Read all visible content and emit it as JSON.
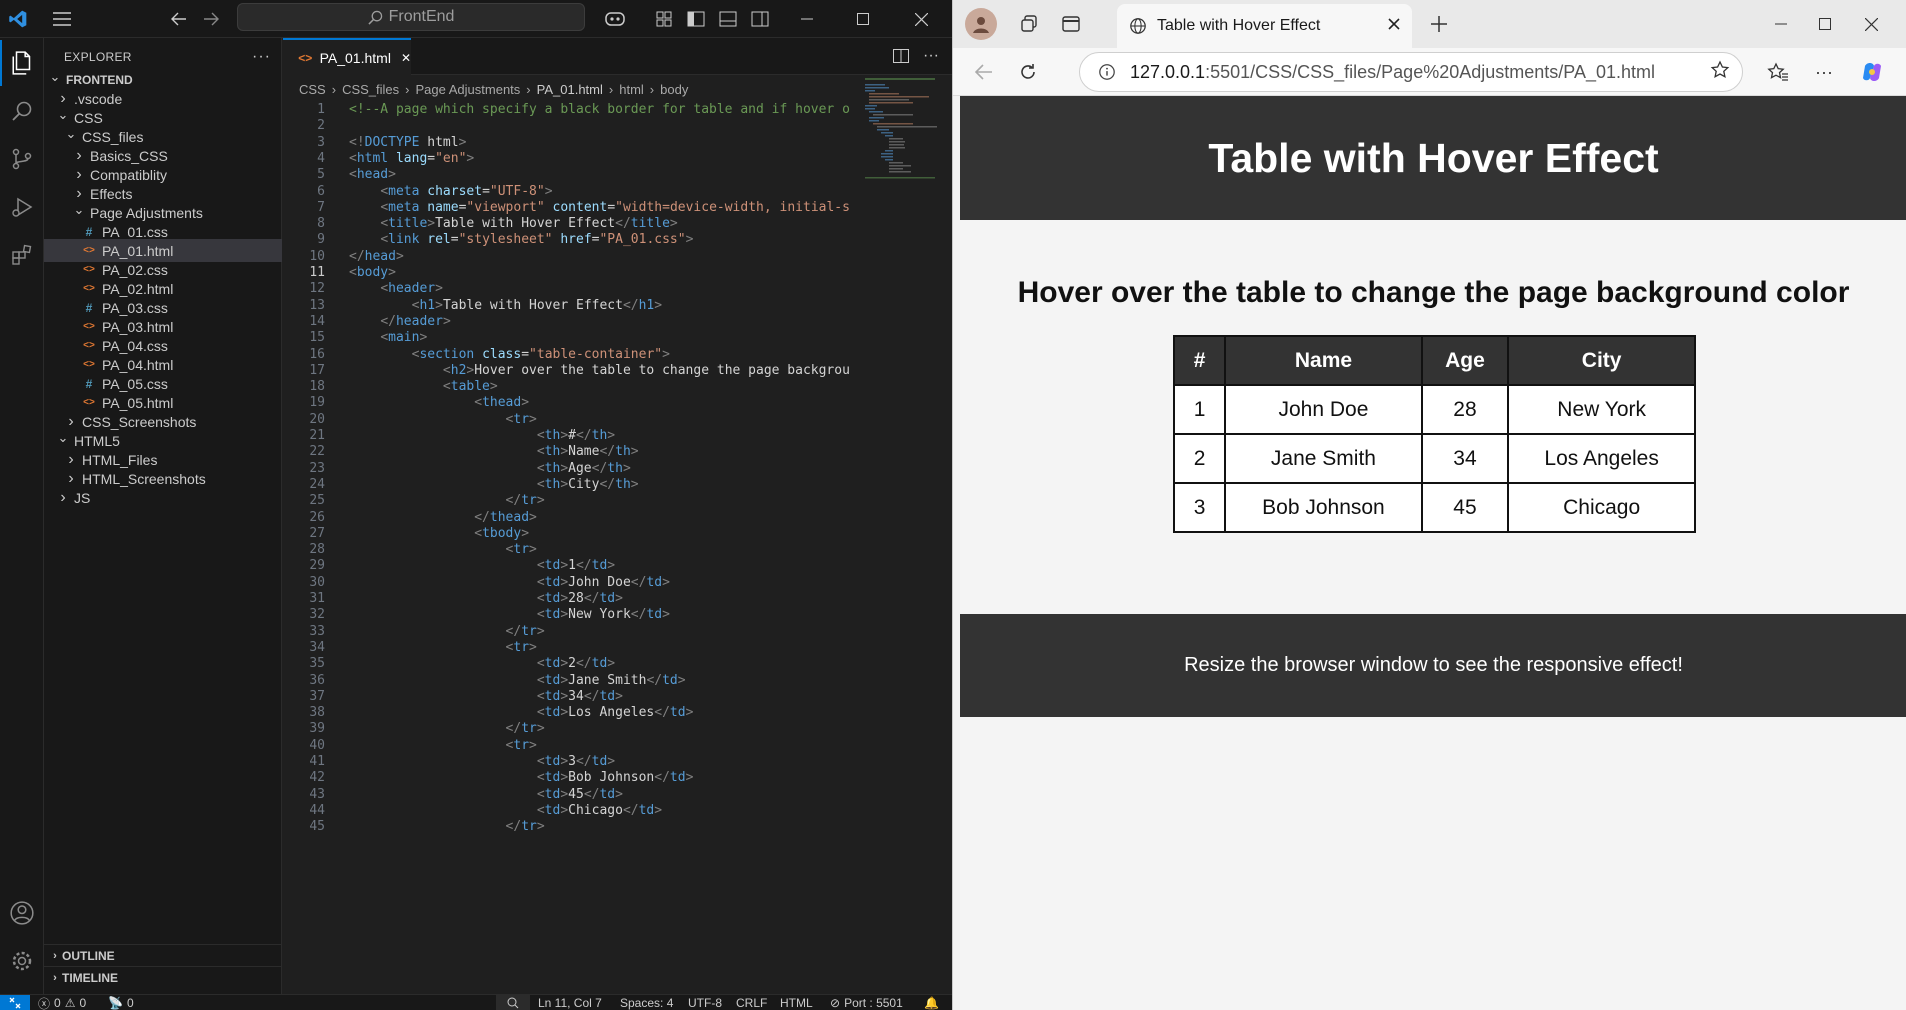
{
  "vscode": {
    "title": "FrontEnd",
    "explorer": {
      "header": "EXPLORER",
      "rows": [
        {
          "label": "FRONTEND",
          "depth": 0,
          "kind": "root"
        },
        {
          "label": ".vscode",
          "depth": 1,
          "kind": "folder"
        },
        {
          "label": "CSS",
          "depth": 1,
          "kind": "folder-open"
        },
        {
          "label": "CSS_files",
          "depth": 2,
          "kind": "folder-open"
        },
        {
          "label": "Basics_CSS",
          "depth": 3,
          "kind": "folder"
        },
        {
          "label": "Compatiblity",
          "depth": 3,
          "kind": "folder"
        },
        {
          "label": "Effects",
          "depth": 3,
          "kind": "folder"
        },
        {
          "label": "Page Adjustments",
          "depth": 3,
          "kind": "folder-open"
        },
        {
          "label": "PA_01.css",
          "depth": 4,
          "kind": "css"
        },
        {
          "label": "PA_01.html",
          "depth": 4,
          "kind": "html",
          "selected": true
        },
        {
          "label": "PA_02.css",
          "depth": 4,
          "kind": "html"
        },
        {
          "label": "PA_02.html",
          "depth": 4,
          "kind": "html"
        },
        {
          "label": "PA_03.css",
          "depth": 4,
          "kind": "css"
        },
        {
          "label": "PA_03.html",
          "depth": 4,
          "kind": "html"
        },
        {
          "label": "PA_04.css",
          "depth": 4,
          "kind": "html"
        },
        {
          "label": "PA_04.html",
          "depth": 4,
          "kind": "html"
        },
        {
          "label": "PA_05.css",
          "depth": 4,
          "kind": "css"
        },
        {
          "label": "PA_05.html",
          "depth": 4,
          "kind": "html"
        },
        {
          "label": "CSS_Screenshots",
          "depth": 2,
          "kind": "folder"
        },
        {
          "label": "HTML5",
          "depth": 1,
          "kind": "folder-open"
        },
        {
          "label": "HTML_Files",
          "depth": 2,
          "kind": "folder"
        },
        {
          "label": "HTML_Screenshots",
          "depth": 2,
          "kind": "folder"
        },
        {
          "label": "JS",
          "depth": 1,
          "kind": "folder"
        }
      ],
      "outline": "OUTLINE",
      "timeline": "TIMELINE"
    },
    "tab": {
      "label": "PA_01.html",
      "close": "✕"
    },
    "breadcrumb": [
      "CSS",
      "CSS_files",
      "Page Adjustments",
      "PA_01.html",
      "html",
      "body"
    ],
    "current_line": 11,
    "code_lines": [
      "<!--A page which specify a black border for table and if hover o",
      "",
      "<!DOCTYPE html>",
      "<html lang=\"en\">",
      "<head>",
      "    <meta charset=\"UTF-8\">",
      "    <meta name=\"viewport\" content=\"width=device-width, initial-s",
      "    <title>Table with Hover Effect</title>",
      "    <link rel=\"stylesheet\" href=\"PA_01.css\">",
      "</head>",
      "<body>",
      "    <header>",
      "        <h1>Table with Hover Effect</h1>",
      "    </header>",
      "    <main>",
      "        <section class=\"table-container\">",
      "            <h2>Hover over the table to change the page backgrou",
      "            <table>",
      "                <thead>",
      "                    <tr>",
      "                        <th>#</th>",
      "                        <th>Name</th>",
      "                        <th>Age</th>",
      "                        <th>City</th>",
      "                    </tr>",
      "                </thead>",
      "                <tbody>",
      "                    <tr>",
      "                        <td>1</td>",
      "                        <td>John Doe</td>",
      "                        <td>28</td>",
      "                        <td>New York</td>",
      "                    </tr>",
      "                    <tr>",
      "                        <td>2</td>",
      "                        <td>Jane Smith</td>",
      "                        <td>34</td>",
      "                        <td>Los Angeles</td>",
      "                    </tr>",
      "                    <tr>",
      "                        <td>3</td>",
      "                        <td>Bob Johnson</td>",
      "                        <td>45</td>",
      "                        <td>Chicago</td>",
      "                    </tr>"
    ],
    "status": {
      "errors": "0",
      "warnings": "0",
      "ports": "0",
      "position": "Ln 11, Col 7",
      "spaces": "Spaces: 4",
      "encoding": "UTF-8",
      "eol": "CRLF",
      "language": "HTML",
      "port": "Port : 5501"
    },
    "colors": {
      "tag": "#569cd6",
      "attr": "#9cdcfe",
      "string": "#ce9178",
      "comment": "#6a9955",
      "text": "#d4d4d4",
      "accent": "#0078d4"
    }
  },
  "browser": {
    "tab_title": "Table with Hover Effect",
    "url_host": "127.0.0.1",
    "url_rest": ":5501/CSS/CSS_files/Page%20Adjustments/PA_01.html",
    "page": {
      "heading": "Table with Hover Effect",
      "subheading": "Hover over the table to change the page background color",
      "columns": [
        "#",
        "Name",
        "Age",
        "City"
      ],
      "rows": [
        [
          "1",
          "John Doe",
          "28",
          "New York"
        ],
        [
          "2",
          "Jane Smith",
          "34",
          "Los Angeles"
        ],
        [
          "3",
          "Bob Johnson",
          "45",
          "Chicago"
        ]
      ],
      "footer": "Resize the browser window to see the responsive effect!"
    }
  }
}
